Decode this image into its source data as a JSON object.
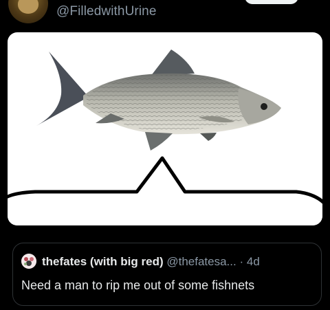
{
  "author": {
    "handle": "@FilledwithUrine",
    "avatar_icon": "dog-avatar-icon"
  },
  "image": {
    "subject_icon": "fish-icon",
    "bubble_icon": "speech-bubble-icon"
  },
  "quoted_post": {
    "display_name": "thefates (with big red)",
    "handle": "@thefatesa...",
    "separator": "·",
    "time": "4d",
    "text": "Need a man to rip me out of some fishnets",
    "avatar_icon": "avatar-icon"
  },
  "colors": {
    "background": "#000000",
    "secondary_text": "#8b98a5",
    "primary_text": "#e7e9ea",
    "border": "#2f3336"
  }
}
